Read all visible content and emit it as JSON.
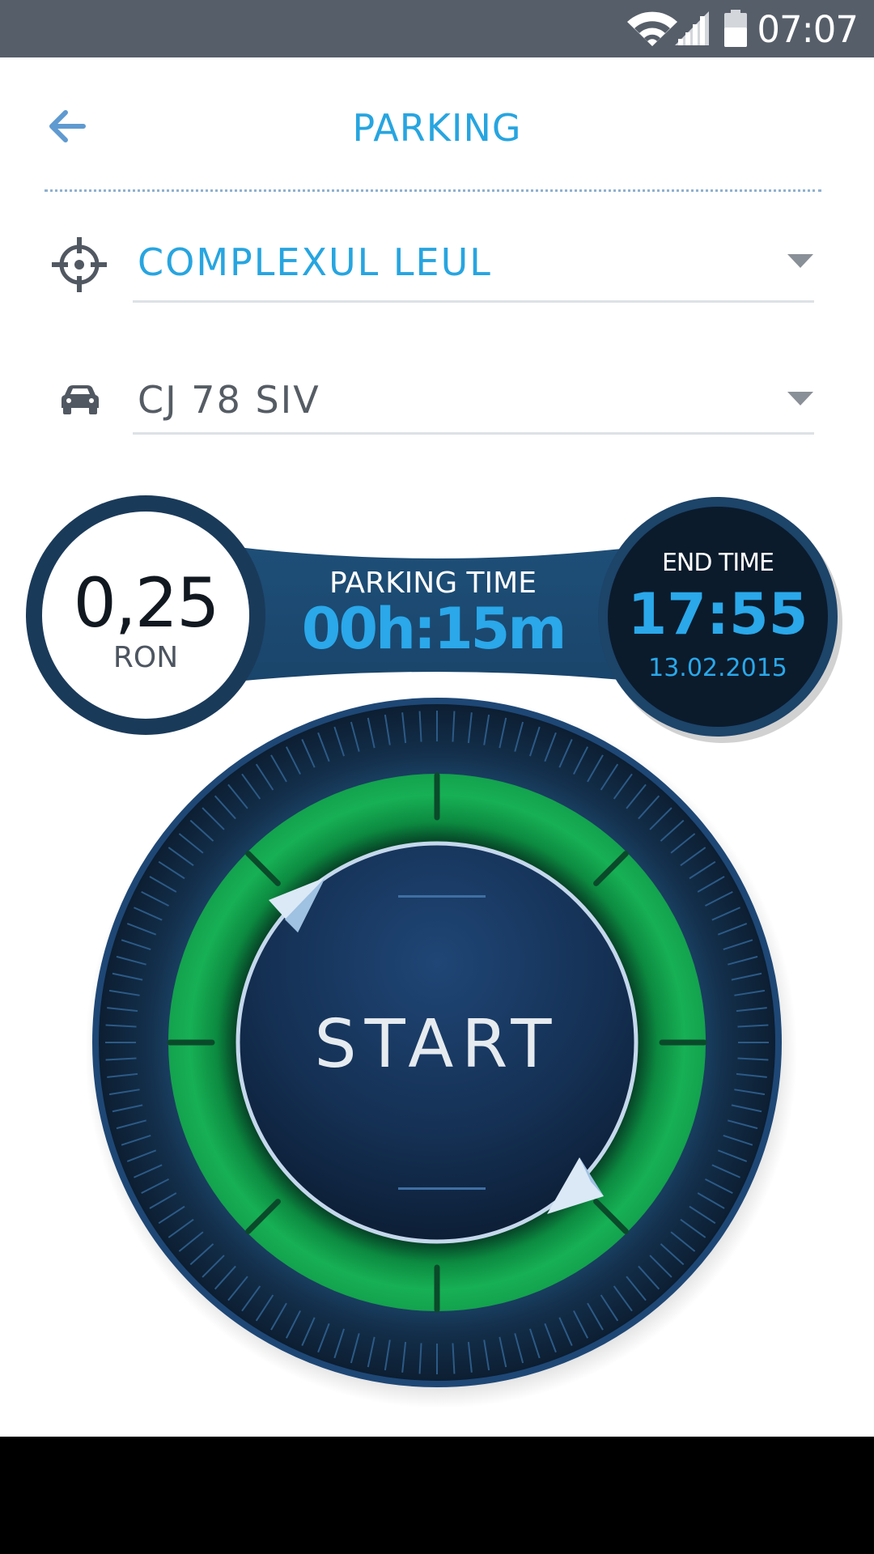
{
  "status_bar": {
    "time": "07:07",
    "icons": [
      "wifi-icon",
      "signal-icon",
      "battery-icon"
    ]
  },
  "header": {
    "title": "PARKING",
    "back_icon": "arrow-left-icon"
  },
  "location": {
    "icon": "location-target-icon",
    "value": "COMPLEXUL LEUL",
    "dropdown_icon": "chevron-down-icon"
  },
  "vehicle": {
    "icon": "car-icon",
    "value": "CJ 78 SIV",
    "dropdown_icon": "chevron-down-icon"
  },
  "cost": {
    "amount": "0,25",
    "currency": "RON"
  },
  "parking_time": {
    "label": "PARKING TIME",
    "value": "00h:15m"
  },
  "end_time": {
    "label": "END TIME",
    "time": "17:55",
    "date": "13.02.2015"
  },
  "dial": {
    "button_label": "START"
  },
  "colors": {
    "accent_blue": "#27a5e0",
    "navy": "#1d3c5c",
    "dark_navy": "#0b1b2c",
    "green": "#16a84e",
    "status_bar": "#565e69"
  }
}
